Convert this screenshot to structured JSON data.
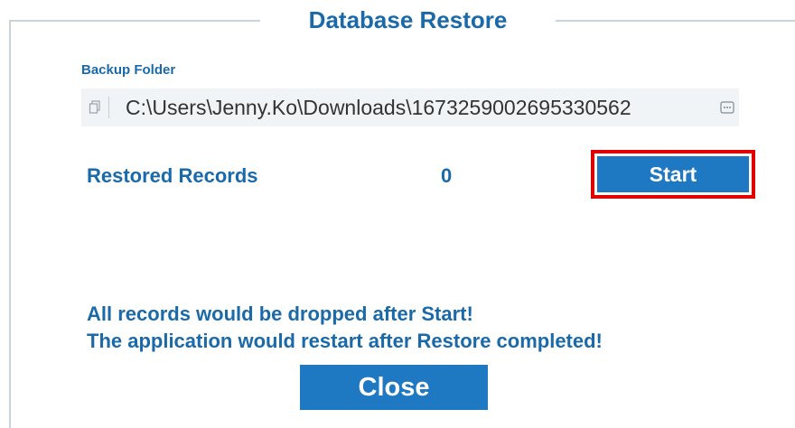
{
  "dialog": {
    "title": "Database Restore"
  },
  "backup_folder": {
    "label": "Backup Folder",
    "path": "C:\\Users\\Jenny.Ko\\Downloads\\1673259002695330562",
    "copy_icon": "copy-icon",
    "browse_icon": "ellipsis-browse-icon"
  },
  "restore": {
    "records_label": "Restored Records",
    "records_count": "0",
    "start_label": "Start",
    "highlight_color": "#e00000"
  },
  "warnings": {
    "line1": "All records would be dropped after Start!",
    "line2": "The application would restart after Restore completed!"
  },
  "actions": {
    "close_label": "Close"
  },
  "colors": {
    "accent": "#1a6aaa",
    "button": "#1f78c2"
  }
}
